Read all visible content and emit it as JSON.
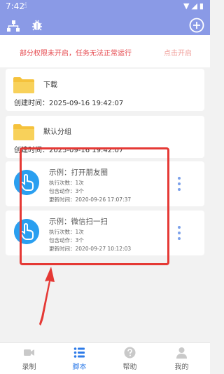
{
  "status_bar": {
    "time": "7:42"
  },
  "colors": {
    "header": "#8a9ae6",
    "accent": "#2e7be8",
    "warning": "#e5484d",
    "annotation": "#e53935"
  },
  "header": {
    "icons": [
      "tree-icon",
      "bug-icon",
      "add-circle-icon"
    ]
  },
  "warning": {
    "text": "部分权限未开启，任务无法正常运行",
    "link": "点击开启"
  },
  "folders": [
    {
      "name": "下载",
      "created": "创建时间：2025-09-16 19:42:07"
    },
    {
      "name": "默认分组",
      "created": "创建时间：2025-09-16 19:42:07"
    }
  ],
  "scripts": [
    {
      "title": "示例：打开朋友圈",
      "runs": "执行次数：1次",
      "actions": "包含动作：3个",
      "updated": "更新时间：2020-09-26 17:07:37"
    },
    {
      "title": "示例：微信扫一扫",
      "runs": "执行次数：1次",
      "actions": "包含动作：3个",
      "updated": "更新时间：2020-09-27 10:12:03"
    }
  ],
  "nav": [
    {
      "label": "录制",
      "icon": "record-icon"
    },
    {
      "label": "脚本",
      "icon": "script-list-icon",
      "active": true
    },
    {
      "label": "帮助",
      "icon": "help-icon"
    },
    {
      "label": "我的",
      "icon": "profile-icon"
    }
  ]
}
